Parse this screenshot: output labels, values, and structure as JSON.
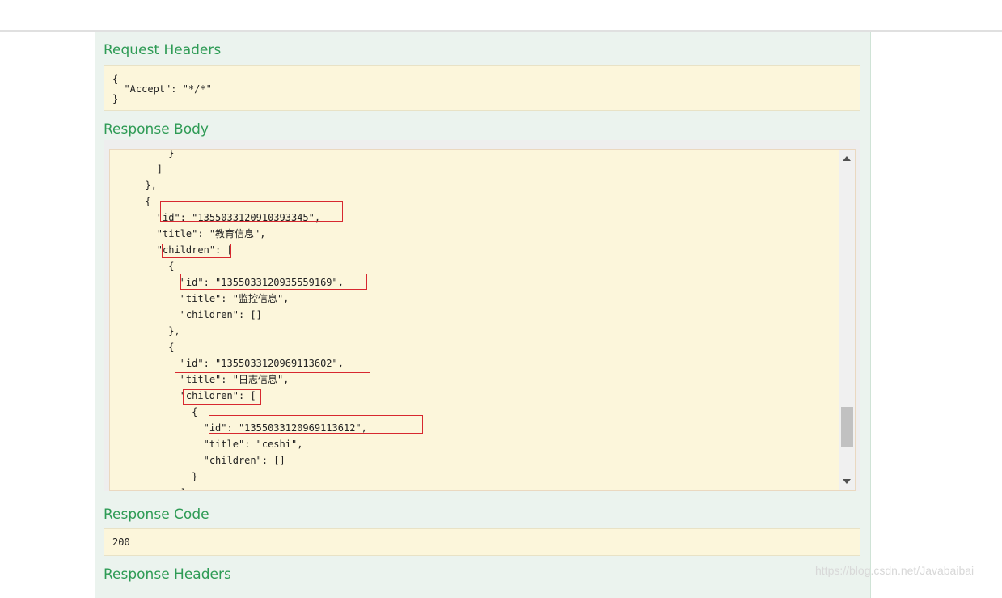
{
  "request_headers": {
    "title": "Request Headers",
    "code": "{\n  \"Accept\": \"*/*\"\n}"
  },
  "response_body": {
    "title": "Response Body",
    "lines": [
      "          }",
      "        ]",
      "      },",
      "      {",
      "        \"id\": \"1355033120910393345\",",
      "        \"title\": \"教育信息\",",
      "        \"children\": [",
      "          {",
      "            \"id\": \"1355033120935559169\",",
      "            \"title\": \"监控信息\",",
      "            \"children\": []",
      "          },",
      "          {",
      "            \"id\": \"1355033120969113602\",",
      "            \"title\": \"日志信息\",",
      "            \"children\": [",
      "              {",
      "                \"id\": \"1355033120969113612\",",
      "                \"title\": \"ceshi\",",
      "                \"children\": []",
      "              }",
      "            ]"
    ]
  },
  "response_code": {
    "title": "Response Code",
    "value": "200"
  },
  "response_headers": {
    "title": "Response Headers"
  },
  "watermark": "https://blog.csdn.net/Javabaibai",
  "colors": {
    "section_title": "#2e9b55",
    "code_background": "#fcf6db",
    "panel_background": "#ebf3ee",
    "highlight_box": "#d7282f"
  }
}
